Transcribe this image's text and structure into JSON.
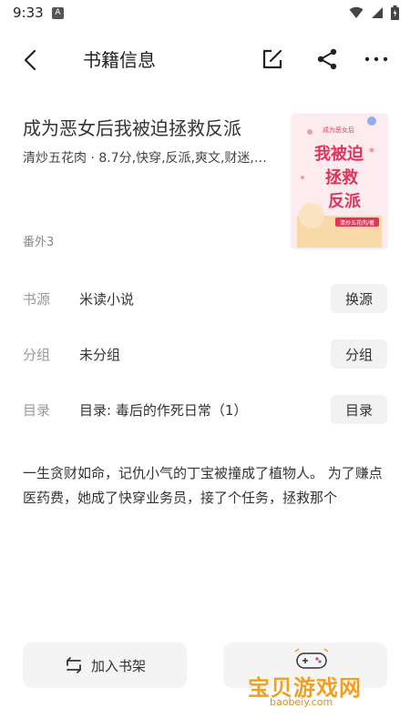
{
  "status": {
    "time": "9:33",
    "indicator": "A"
  },
  "header": {
    "title": "书籍信息"
  },
  "book": {
    "title": "成为恶女后我被迫拯救反派",
    "meta": "清炒五花肉 · 8.7分,快穿,反派,爽文,财迷,科…",
    "extra": "番外3",
    "cover": {
      "text_small": "成为恶女后",
      "text_big": "我被迫拯救反派",
      "author": "清炒五花肉/著"
    }
  },
  "rows": [
    {
      "label": "书源",
      "value": "米读小说",
      "button": "换源"
    },
    {
      "label": "分组",
      "value": "未分组",
      "button": "分组"
    },
    {
      "label": "目录",
      "value": "目录: 毒后的作死日常（1）",
      "button": "目录"
    }
  ],
  "description": "一生贪财如命，记仇小气的丁宝被撞成了植物人。 为了赚点医药费，她成了快穿业务员，接了个任务，拯救那个",
  "actions": {
    "add_to_shelf": "加入书架"
  },
  "watermark": {
    "main": "宝贝游戏网",
    "sub": "baobeiy.com"
  },
  "colors": {
    "accent": "#f0a020",
    "button_bg": "#f2f2f2"
  }
}
